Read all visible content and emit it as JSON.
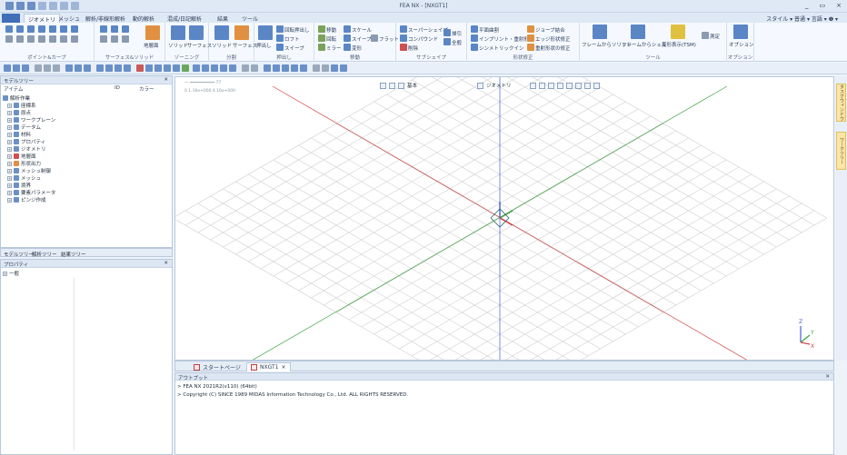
{
  "window": {
    "title": "FEA NX - [NXGT1]",
    "controls": [
      "_",
      "▭",
      "×"
    ]
  },
  "ribbon_tabs": {
    "file": "",
    "tabs": [
      "ジオメトリ",
      "メッシュ",
      "解析/非線形解析",
      "動的解析",
      "混成/日記解析",
      "結果",
      "ツール"
    ],
    "right": "スタイル ▾ 普通 ▾ 言語 ▾ ❶ ▾"
  },
  "ribbon_groups": [
    {
      "label": "ポイント&カーブ"
    },
    {
      "label": "サーフェス&ソリッド"
    },
    {
      "label": "ゾーニング"
    },
    {
      "label": "分割"
    },
    {
      "label": "押出し"
    },
    {
      "label": "移動"
    },
    {
      "label": "サブシェイプ"
    },
    {
      "label": "形状修正"
    },
    {
      "label": "ツール"
    },
    {
      "label": "オプション"
    }
  ],
  "ribbon_labels": {
    "hole": "地層面",
    "solid": "ソリッド",
    "surface": "サーフェス",
    "solid2": "ソリッド",
    "surface2": "サーフェス",
    "extrude": "押出し",
    "revolve": "回転押出し",
    "loft": "ロフト",
    "sweep": "スイープ",
    "move": "移動",
    "rotate": "回転",
    "mirror": "ミラー",
    "scale": "スケール",
    "sweep2": "スイープ",
    "deform": "変形",
    "flatten": "フラット",
    "supershape": "スーパーシェイプ",
    "compound": "コンパウンド",
    "delete": "削除",
    "sweep3": "掃引",
    "addr": "全般",
    "mesh1": "平面曲割",
    "mesh2": "インプリント・重射形状",
    "mesh3": "シンメトリックイン",
    "mesh4": "ジョーブ結合",
    "mesh5": "エッジ形状修正",
    "mesh6": "重射形状の修正",
    "tool1": "フレームからソリッド",
    "tool2": "フレームからシェル",
    "tool3": "変形表示(TSM)",
    "measure": "測定",
    "option": "オプション"
  },
  "model_tree": {
    "header": "モデルツリー",
    "col_item": "アイテム",
    "col_id": "ID",
    "col_color": "カラー",
    "items": [
      {
        "label": "解析作業",
        "level": 0
      },
      {
        "label": "座標系",
        "level": 1
      },
      {
        "label": "原点",
        "level": 1
      },
      {
        "label": "ワークプレーン",
        "level": 1
      },
      {
        "label": "データム",
        "level": 1
      },
      {
        "label": "材料",
        "level": 1
      },
      {
        "label": "プロパティ",
        "level": 1
      },
      {
        "label": "ジオメトリ",
        "level": 1
      },
      {
        "label": "地層面",
        "level": 1
      },
      {
        "label": "形状出力",
        "level": 1
      },
      {
        "label": "メッシュ制御",
        "level": 1
      },
      {
        "label": "メッシュ",
        "level": 1
      },
      {
        "label": "境界",
        "level": 1
      },
      {
        "label": "要素パラメータ",
        "level": 1
      },
      {
        "label": "ピンジ作成",
        "level": 1
      }
    ]
  },
  "pane_tabs": [
    "モデルツリー",
    "解析ツリー",
    "結果ツリー"
  ],
  "property_pane": {
    "header": "プロパティ",
    "item": "一般"
  },
  "viewport": {
    "info1": "一 ━━━━━━━━━━ 77",
    "info2": "0    1.16e+000    4.16e+000",
    "view_label": "基本",
    "geo_label": "ジオメトリ"
  },
  "side_tabs": [
    "タスクウィンドウ",
    "ワークツリー"
  ],
  "doc_tabs": [
    {
      "label": "スタートページ",
      "active": false
    },
    {
      "label": "NXGT1",
      "active": true
    }
  ],
  "output": {
    "header": "アウトプット",
    "lines": [
      "> FEA NX 2021R2(v110) (64bit)",
      "> Copyright (C) SINCE 1989 MIDAS Information Technology Co., Ltd. ALL RIGHTS RESERVED."
    ]
  },
  "axes": {
    "x": "X",
    "y": "Y",
    "z": "Z"
  },
  "colors": {
    "accent": "#3f6fb7",
    "grid": "#cfcfcf",
    "axis_x": "#d04040",
    "axis_y": "#40a040",
    "axis_z": "#4060d0"
  }
}
